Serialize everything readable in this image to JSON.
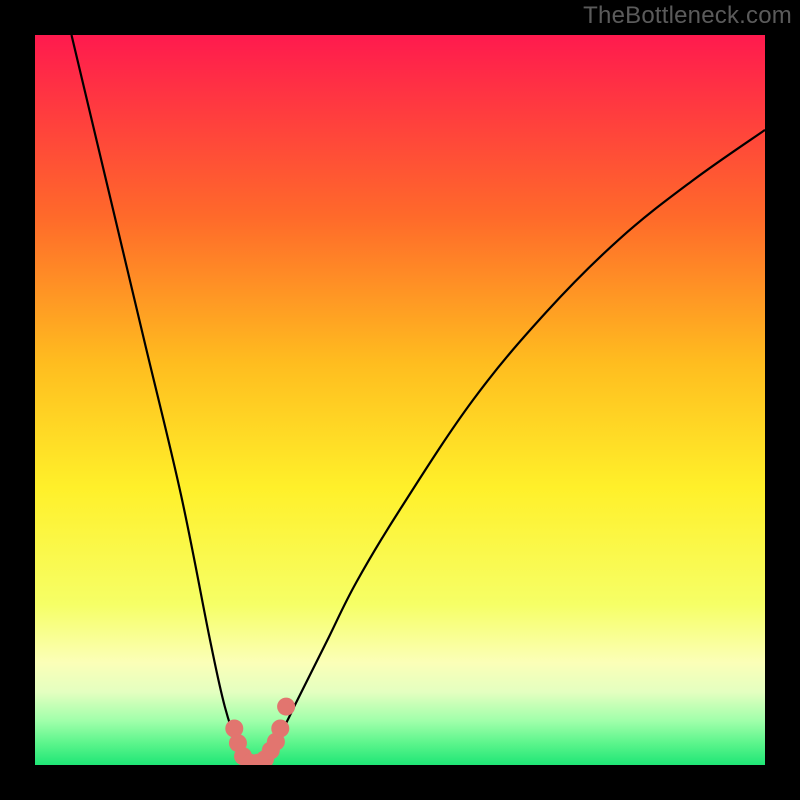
{
  "watermark": "TheBottleneck.com",
  "chart_data": {
    "type": "line",
    "title": "",
    "xlabel": "",
    "ylabel": "",
    "xlim": [
      0,
      100
    ],
    "ylim": [
      0,
      100
    ],
    "series": [
      {
        "name": "bottleneck-curve",
        "x": [
          5,
          10,
          15,
          20,
          24,
          26,
          28,
          29,
          30,
          31,
          32,
          34,
          36,
          40,
          44,
          50,
          60,
          70,
          80,
          90,
          100
        ],
        "y": [
          100,
          79,
          58,
          37,
          17,
          8,
          2,
          0.5,
          0,
          0.5,
          2,
          5,
          9,
          17,
          25,
          35,
          50,
          62,
          72,
          80,
          87
        ]
      }
    ],
    "markers": {
      "name": "highlight-points",
      "x": [
        27.3,
        27.8,
        28.5,
        29.5,
        30.5,
        31.5,
        32.3,
        33.0,
        33.6,
        34.4
      ],
      "y": [
        5.0,
        3.0,
        1.2,
        0.3,
        0.3,
        0.8,
        2.0,
        3.2,
        5.0,
        8.0
      ]
    },
    "gradient_stops": [
      {
        "pos": 0.0,
        "color": "#ff1a4e"
      },
      {
        "pos": 0.25,
        "color": "#ff6a2a"
      },
      {
        "pos": 0.45,
        "color": "#ffbd1f"
      },
      {
        "pos": 0.62,
        "color": "#fff02a"
      },
      {
        "pos": 0.78,
        "color": "#f6ff66"
      },
      {
        "pos": 0.86,
        "color": "#fbffb8"
      },
      {
        "pos": 0.9,
        "color": "#e4ffc0"
      },
      {
        "pos": 0.94,
        "color": "#9fffaa"
      },
      {
        "pos": 0.97,
        "color": "#5cf58c"
      },
      {
        "pos": 1.0,
        "color": "#1fe676"
      }
    ],
    "curve_color": "#000000",
    "marker_color": "#e2756f",
    "marker_radius": 9
  }
}
